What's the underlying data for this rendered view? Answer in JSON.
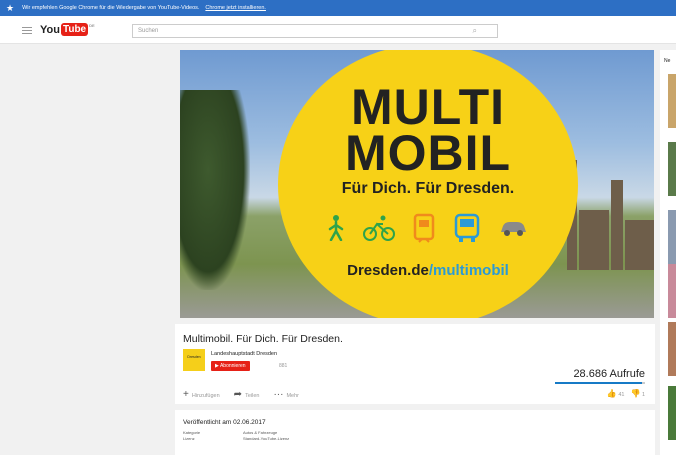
{
  "banner": {
    "text": "Wir empfehlen Google Chrome für die Wiedergabe von YouTube-Videos.",
    "link": "Chrome jetzt installieren."
  },
  "masthead": {
    "logo_you": "You",
    "logo_tube": "Tube",
    "logo_region": "DE",
    "search_placeholder": "Suchen"
  },
  "video_frame": {
    "headline_line1": "MULTI",
    "headline_line2": "MOBIL",
    "tagline": "Für Dich. Für Dresden.",
    "url_main": "Dresden.de",
    "url_highlight": "/multimobil",
    "modes": [
      "walk-icon",
      "bike-icon",
      "tram-icon",
      "bus-icon",
      "car-icon"
    ],
    "colors": {
      "circle": "#f7d117",
      "icons_green": "#2fa34a",
      "icons_orange": "#f08a1c",
      "icons_blue": "#2b9ad6"
    }
  },
  "info": {
    "title": "Multimobil. Für Dich. Für Dresden.",
    "channel_name": "Landeshauptstadt Dresden",
    "channel_logo_text": "Dresden",
    "subscribe_label": "Abonnieren",
    "subscriber_count": "881",
    "views": "28.686 Aufrufe",
    "like_ratio": 0.97,
    "actions": {
      "add": "Hinzufügen",
      "share": "Teilen",
      "more": "Mehr"
    },
    "likes": "41",
    "dislikes": "1"
  },
  "description": {
    "published": "Veröffentlicht am 02.06.2017",
    "meta": [
      {
        "key": "Kategorie",
        "value": "Autos & Fahrzeuge"
      },
      {
        "key": "Lizenz",
        "value": "Standard-YouTube-Lizenz"
      }
    ]
  },
  "sidebar": {
    "heading": "Ne"
  }
}
